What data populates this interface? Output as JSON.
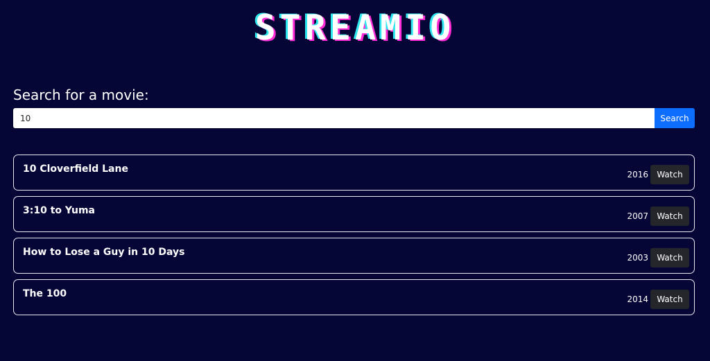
{
  "header": {
    "logo_text": "STREAMIO"
  },
  "search": {
    "heading": "Search for a movie:",
    "value": "10",
    "button_label": "Search"
  },
  "results": [
    {
      "title": "10 Cloverfield Lane",
      "year": "2016",
      "action_label": "Watch"
    },
    {
      "title": "3:10 to Yuma",
      "year": "2007",
      "action_label": "Watch"
    },
    {
      "title": "How to Lose a Guy in 10 Days",
      "year": "2003",
      "action_label": "Watch"
    },
    {
      "title": "The 100",
      "year": "2014",
      "action_label": "Watch"
    }
  ],
  "colors": {
    "background": "#050636",
    "accent": "#0d6efd",
    "logo_shadow_cyan": "#2ee6ee",
    "logo_shadow_magenta": "#ff2bd6"
  }
}
